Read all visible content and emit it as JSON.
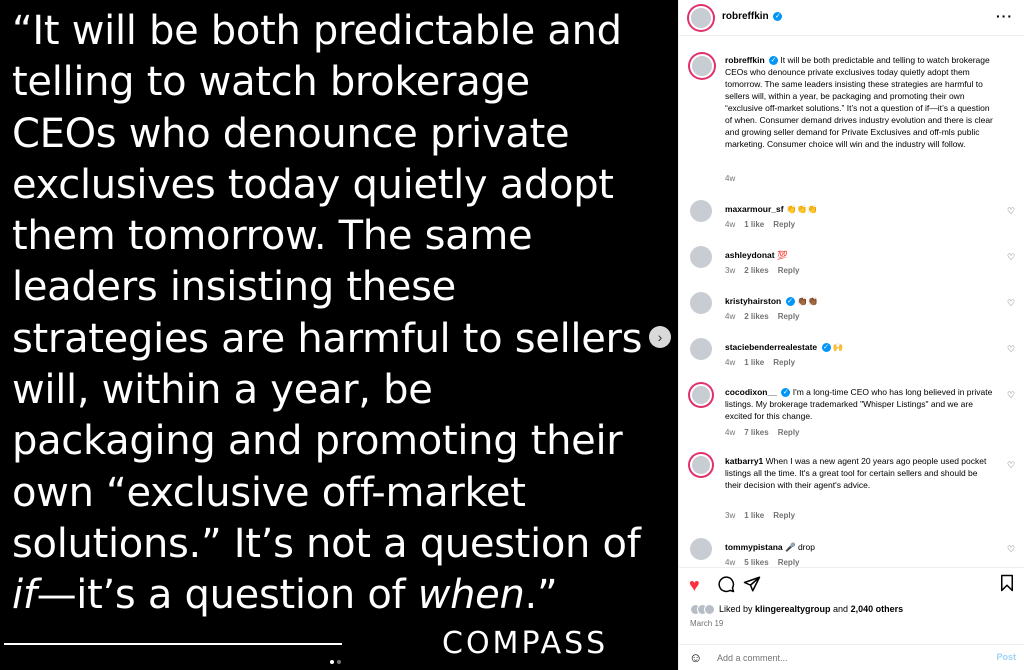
{
  "post": {
    "quote_lines": [
      "“It will be both predictable and",
      "telling to watch brokerage",
      "CEOs who denounce private",
      "exclusives today quietly adopt",
      "them tomorrow. The same",
      "leaders insisting these",
      "strategies are harmful to sellers",
      "will, within a year, be",
      "packaging and promoting their",
      "own “exclusive off-market",
      "solutions.” It’s not a question of"
    ],
    "quote_last": {
      "if": "if",
      "middle": "—it’s a question of ",
      "when": "when",
      "end": ".”"
    },
    "brand": "COMPASS"
  },
  "header": {
    "username": "robreffkin",
    "verified_icon": "verified-badge-icon",
    "more_icon": "more-options-icon"
  },
  "caption": {
    "username": "robreffkin",
    "text": "It will be both predictable and telling to watch brokerage CEOs who denounce private exclusives today quietly adopt them tomorrow. The same leaders insisting these strategies are harmful to sellers will, within a year, be packaging and promoting their own “exclusive off-market solutions.” It’s not a question of if—it’s a question of when. Consumer demand drives industry evolution and there is clear and growing seller demand for Private Exclusives and off-mls public marketing. Consumer choice will win and the industry will follow.",
    "time": "4w"
  },
  "comments": [
    {
      "username": "maxarmour_sf",
      "verified": false,
      "text": "👏👏👏",
      "time": "4w",
      "likes": "1 like",
      "reply": "Reply"
    },
    {
      "username": "ashleydonat",
      "verified": false,
      "text": "💯",
      "time": "3w",
      "likes": "2 likes",
      "reply": "Reply"
    },
    {
      "username": "kristyhairston",
      "verified": true,
      "text": "👏🏾👏🏾",
      "time": "4w",
      "likes": "2 likes",
      "reply": "Reply"
    },
    {
      "username": "staciebenderrealestate",
      "verified": true,
      "text": "🙌",
      "time": "4w",
      "likes": "1 like",
      "reply": "Reply"
    },
    {
      "username": "cocodixon__",
      "verified": true,
      "text": "I'm a long-time CEO who has long believed in private listings. My brokerage trademarked \"Whisper Listings\" and we are excited for this change.",
      "time": "4w",
      "likes": "7 likes",
      "reply": "Reply"
    },
    {
      "username": "katbarry1",
      "verified": false,
      "text": "When I was a new agent 20 years ago people used pocket listings all the time. It's a great tool for certain sellers and should be their decision with their agent's advice.",
      "time": "3w",
      "likes": "1 like",
      "reply": "Reply"
    },
    {
      "username": "tommypistana",
      "verified": false,
      "text": "🎤 drop",
      "time": "4w",
      "likes": "5 likes",
      "reply": "Reply"
    }
  ],
  "actions": {
    "like_icon": "heart-filled-icon",
    "comment_icon": "comment-icon",
    "share_icon": "share-icon",
    "save_icon": "bookmark-icon",
    "liked_by_prefix": "Liked by ",
    "liked_by_user": "klingerealtygroup",
    "liked_by_and": " and ",
    "liked_by_others": "2,040 others",
    "date": "March 19"
  },
  "composer": {
    "placeholder": "Add a comment...",
    "post_label": "Post"
  },
  "colors": {
    "like_red": "#ff3040",
    "verified_blue": "#0095f6",
    "post_disabled": "#9ed3f9"
  }
}
